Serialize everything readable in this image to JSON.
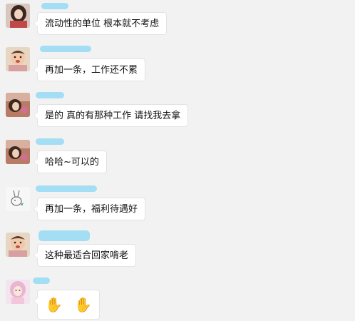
{
  "colors": {
    "background": "#f2f2f2",
    "bubble": "#ffffff",
    "bubble_border": "#e3e3e3",
    "name_blur": "#9fdcf3"
  },
  "messages": [
    {
      "text": "流动性的单位 根本就不考虑",
      "avatar_icon": "girl-portrait-avatar"
    },
    {
      "text": "再加一条，工作还不累",
      "avatar_icon": "baby-avatar"
    },
    {
      "text": "是的  真的有那种工作  请找我去拿",
      "avatar_icon": "child-photo-avatar"
    },
    {
      "text": "哈哈~可以的",
      "avatar_icon": "child-photo-avatar"
    },
    {
      "text": "再加一条，福利待遇好",
      "avatar_icon": "rabbit-sketch-avatar"
    },
    {
      "text": "这种最适合回家啃老",
      "avatar_icon": "baby-avatar"
    },
    {
      "emoji": [
        "✋",
        "✋"
      ],
      "emoji_icon": "raised-hand-icon",
      "avatar_icon": "anime-girl-avatar"
    }
  ]
}
